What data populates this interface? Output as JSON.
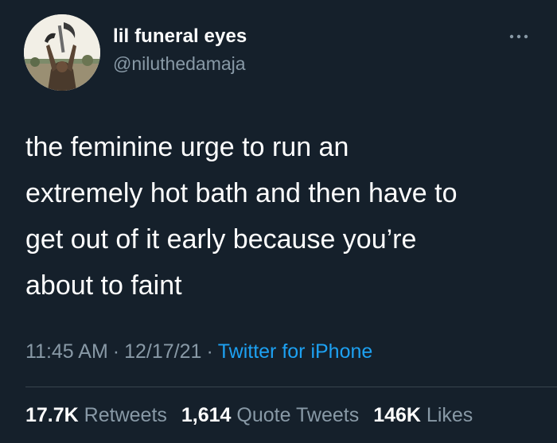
{
  "tweet": {
    "display_name": "lil funeral eyes",
    "handle": "@niluthedamaja",
    "text_lines": [
      "the feminine urge to run an",
      "extremely hot bath and then have to",
      "get out of it early because you’re",
      "about to faint"
    ],
    "time": "11:45 AM",
    "date": "12/17/21",
    "separator": "·",
    "source": "Twitter for iPhone",
    "stats": {
      "retweets_count": "17.7K",
      "retweets_label": "Retweets",
      "quotes_count": "1,614",
      "quotes_label": "Quote Tweets",
      "likes_count": "146K",
      "likes_label": "Likes"
    }
  },
  "icons": {
    "avatar": "profile-avatar",
    "more": "more-options-icon"
  },
  "colors": {
    "background": "#15202b",
    "primary_text": "#ffffff",
    "secondary_text": "#8899a6",
    "link": "#1da1f2",
    "divider": "#38444d"
  }
}
